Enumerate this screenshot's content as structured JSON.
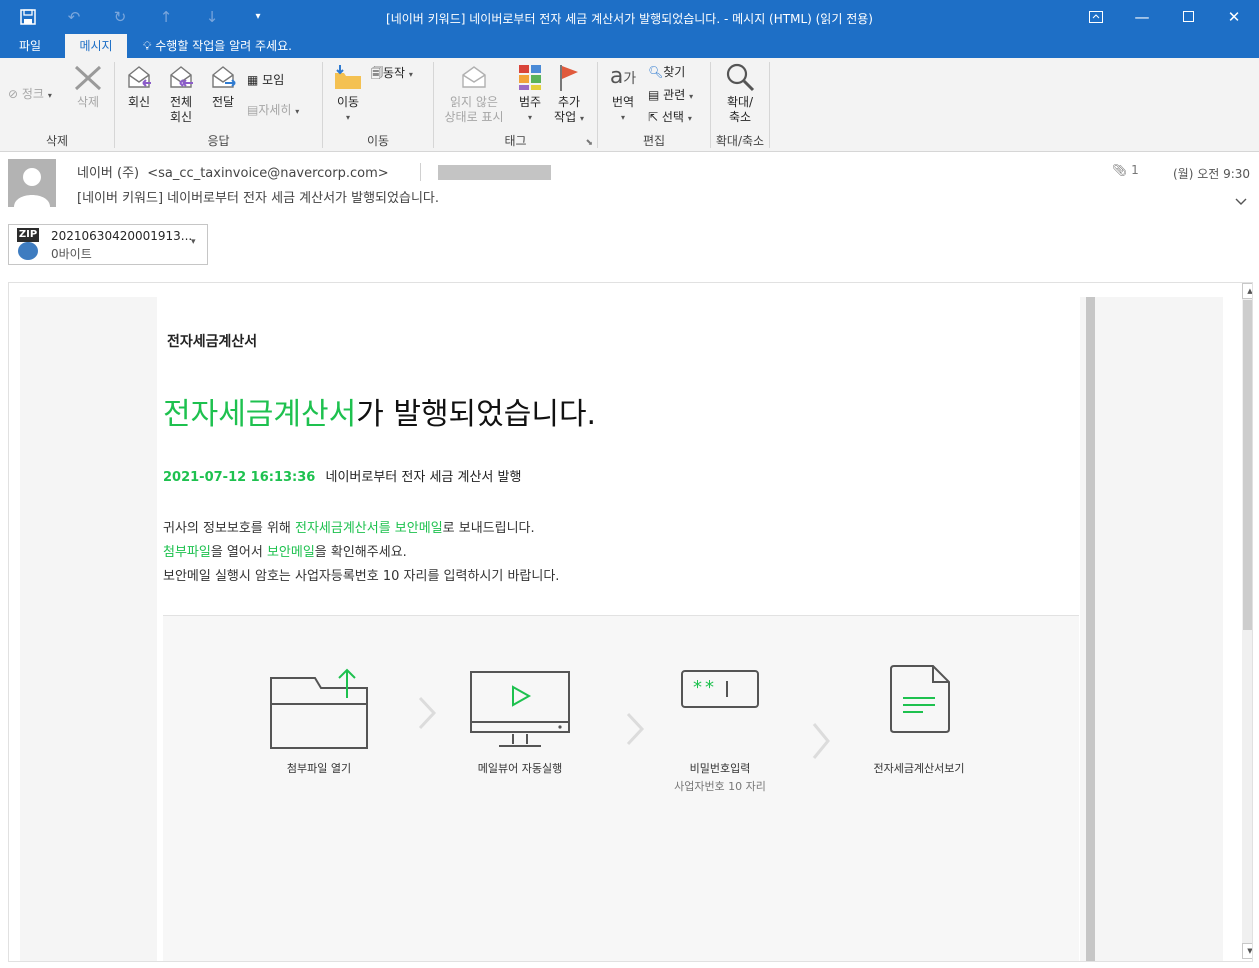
{
  "window": {
    "title": "[네이버 키워드] 네이버로부터 전자 세금 계산서가 발행되었습니다. - 메시지 (HTML) (읽기 전용)"
  },
  "quick_access": [
    "save-icon",
    "undo-icon",
    "redo-icon",
    "up-icon",
    "down-icon",
    "customize-icon"
  ],
  "tabs": {
    "file": "파일",
    "message": "메시지"
  },
  "tell_me": "수행할 작업을 알려 주세요.",
  "ribbon": {
    "groups": {
      "delete": "삭제",
      "respond": "응답",
      "move": "이동",
      "tags": "태그",
      "editing": "편집",
      "zoom": "확대/축소"
    },
    "junk": "정크",
    "delete_btn": "삭제",
    "reply": "회신",
    "reply_all_1": "전체",
    "reply_all_2": "회신",
    "forward": "전달",
    "meeting": "모임",
    "more": "자세히",
    "move_btn": "이동",
    "actions": "동작",
    "mark_unread_1": "읽지 않은",
    "mark_unread_2": "상태로 표시",
    "categorize": "범주",
    "followup_1": "추가",
    "followup_2": "작업",
    "translate": "번역",
    "find": "찾기",
    "related": "관련",
    "select": "선택",
    "zoom_1": "확대/",
    "zoom_2": "축소"
  },
  "header": {
    "sender_name": "네이버 (주)",
    "sender_email": "<sa_cc_taxinvoice@navercorp.com>",
    "subject": "[네이버 키워드] 네이버로부터 전자 세금 계산서가 발행되었습니다.",
    "attachment_count": "1",
    "time": "(월) 오전 9:30"
  },
  "attachment": {
    "type": "ZIP",
    "name": "20210630420001913...",
    "size": "0바이트"
  },
  "email": {
    "brand": "전자세금계산서",
    "headline_green": "전자세금계산서",
    "headline_rest": "가 발행되었습니다.",
    "datetime": "2021-07-12 16:13:36",
    "datetime_desc": "네이버로부터 전자 세금 계산서 발행",
    "p1_a": "귀사의 정보보호를 위해 ",
    "p1_green": "전자세금계산서를 보안메일",
    "p1_b": "로 보내드립니다.",
    "p2_green1": "첨부파일",
    "p2_a": "을 열어서 ",
    "p2_green2": "보안메일",
    "p2_b": "을 확인해주세요.",
    "p3": "보안메일 실행시 암호는 사업자등록번호 10 자리를 입력하시기 바랍니다.",
    "steps": [
      {
        "label": "첨부파일 열기",
        "sub": ""
      },
      {
        "label": "메일뷰어 자동실행",
        "sub": ""
      },
      {
        "label": "비밀번호입력",
        "sub": "사업자번호 10 자리"
      },
      {
        "label": "전자세금계산서보기",
        "sub": ""
      }
    ],
    "password_mask": "**"
  },
  "colors": {
    "accent": "#1e6fc6",
    "green": "#1ec14f"
  }
}
